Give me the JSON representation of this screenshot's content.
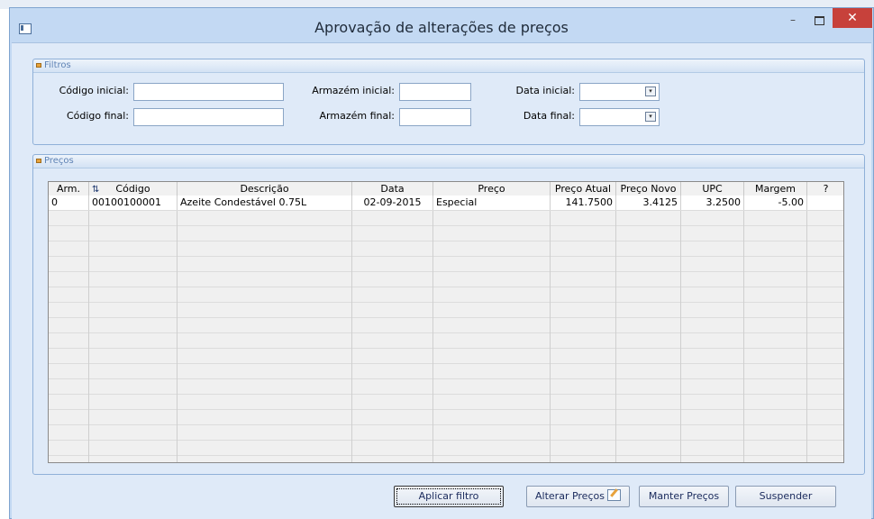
{
  "window": {
    "title": "Aprovação de alterações de preços",
    "min_glyph": "–",
    "close_glyph": "✕"
  },
  "filters": {
    "title": "Filtros",
    "codigo_inicial_label": "Código inicial:",
    "codigo_final_label": "Código final:",
    "armazem_inicial_label": "Armazém inicial:",
    "armazem_final_label": "Armazém final:",
    "data_inicial_label": "Data inicial:",
    "data_final_label": "Data final:",
    "codigo_inicial_value": "",
    "codigo_final_value": "",
    "armazem_inicial_value": "",
    "armazem_final_value": "",
    "data_inicial_value": "",
    "data_final_value": ""
  },
  "precos": {
    "title": "Preços",
    "columns": [
      "Arm.",
      "Código",
      "Descrição",
      "Data",
      "Preço",
      "Preço Atual",
      "Preço Novo",
      "UPC",
      "Margem",
      "?"
    ],
    "rows": [
      [
        "0",
        "00100100001",
        "Azeite Condestável 0.75L",
        "02-09-2015",
        "Especial",
        "141.7500",
        "3.4125",
        "3.2500",
        "-5.00",
        ""
      ]
    ]
  },
  "buttons": {
    "aplicar_filtro": "Aplicar filtro",
    "alterar_precos": "Alterar Preços",
    "manter_precos": "Manter Preços",
    "suspender": "Suspender"
  },
  "icons": {
    "app": "window-icon",
    "group": "collapse-arrow-icon",
    "sort": "sort-az-icon",
    "edit": "edit-icon",
    "calendar": "dropdown-calendar-icon"
  }
}
